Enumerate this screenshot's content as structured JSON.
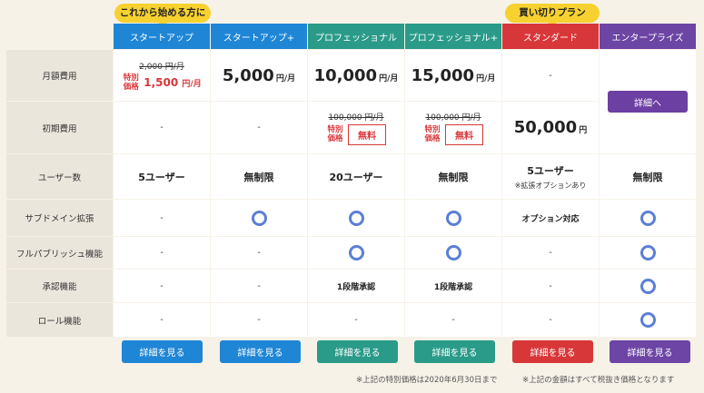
{
  "badges": {
    "beginner": "これから始める方に",
    "buyout": "買い切りプラン"
  },
  "plans": [
    "スタートアップ",
    "スタートアップ+",
    "プロフェッショナル",
    "プロフェッショナル+",
    "スタンダード",
    "エンタープライズ"
  ],
  "rows": {
    "monthly": "月額費用",
    "initial": "初期費用",
    "users": "ユーザー数",
    "subdomain": "サブドメイン拡張",
    "fullpublish": "フルパブリッシュ機能",
    "approval": "承認機能",
    "role": "ロール機能"
  },
  "dash": "-",
  "promo_label": "特別価格",
  "monthly": {
    "c1_orig": "2,000 円/月",
    "c1_promo_num": "1,500",
    "c1_promo_unit": "円/月",
    "c2_num": "5,000",
    "c3_num": "10,000",
    "c4_num": "15,000",
    "unit": "円/月"
  },
  "initial": {
    "c3_orig": "100,000 円/月",
    "c4_orig": "100,000 円/月",
    "free": "無料",
    "c5_num": "50,000",
    "c5_unit": "円"
  },
  "users": {
    "c1": "5ユーザー",
    "c2": "無制限",
    "c3": "20ユーザー",
    "c4": "無制限",
    "c5": "5ユーザー",
    "c5_note": "※拡張オプションあり",
    "c6": "無制限"
  },
  "subdomain_c5": "オプション対応",
  "approval_value": "1段階承認",
  "enterprise_detail": "詳細へ",
  "detail_button": "詳細を見る",
  "footnotes": {
    "left": "※上記の特別価格は2020年6月30日まで",
    "right": "※上記の金額はすべて税抜き価格となります"
  },
  "colors": {
    "blue": "#1f86d6",
    "teal": "#2a9b89",
    "red": "#d8373a",
    "purple": "#6c45a5",
    "badge": "#f7d12f",
    "circle": "#5b7fd6"
  }
}
